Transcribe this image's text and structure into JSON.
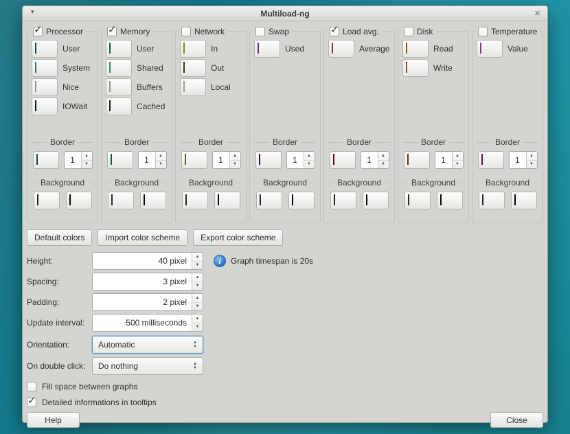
{
  "window": {
    "title": "Multiload-ng"
  },
  "icons": {
    "menu": "▾",
    "close": "×",
    "spin_up": "▲",
    "spin_down": "▼",
    "combo_up": "▲",
    "combo_down": "▼",
    "info": "i",
    "check_glyph": "✓"
  },
  "labels": {
    "border": "Border",
    "background": "Background"
  },
  "graphs": [
    {
      "label": "Processor",
      "check": "✓",
      "colors": [
        {
          "label": "User",
          "color": "#1b7296"
        },
        {
          "label": "System",
          "color": "#4fa8d5"
        },
        {
          "label": "Nice",
          "color": "#c9edfe"
        },
        {
          "label": "IOWait",
          "color": "#07242f"
        }
      ],
      "border": {
        "color": "#1a6a8d",
        "value": "1"
      },
      "background_colors": [
        "#3a3a3a",
        "#0b0b0b"
      ]
    },
    {
      "label": "Memory",
      "check": "✓",
      "colors": [
        {
          "label": "User",
          "color": "#0d9d4b"
        },
        {
          "label": "Shared",
          "color": "#52d389"
        },
        {
          "label": "Buffers",
          "color": "#c7f6db"
        },
        {
          "label": "Cached",
          "color": "#0b3e1e"
        }
      ],
      "border": {
        "color": "#0e9050",
        "value": "1"
      },
      "background_colors": [
        "#3a3a3a",
        "#0b0b0b"
      ]
    },
    {
      "label": "Network",
      "check": "",
      "colors": [
        {
          "label": "In",
          "color": "#d3c70f"
        },
        {
          "label": "Out",
          "color": "#5c5513"
        },
        {
          "label": "Local",
          "color": "#f9f4b3"
        }
      ],
      "border": {
        "color": "#8c8c0e",
        "value": "1"
      },
      "background_colors": [
        "#3a3a3a",
        "#0b0b0b"
      ]
    },
    {
      "label": "Swap",
      "check": "",
      "colors": [
        {
          "label": "Used",
          "color": "#9b44cf"
        }
      ],
      "border": {
        "color": "#5c0f9b",
        "value": "1"
      },
      "background_colors": [
        "#3a3a3a",
        "#0b0b0b"
      ]
    },
    {
      "label": "Load avg.",
      "check": "✓",
      "colors": [
        {
          "label": "Average",
          "color": "#d35052"
        }
      ],
      "border": {
        "color": "#9c0d10",
        "value": "1"
      },
      "background_colors": [
        "#3a3a3a",
        "#0b0b0b"
      ]
    },
    {
      "label": "Disk",
      "check": "",
      "colors": [
        {
          "label": "Read",
          "color": "#e18903"
        },
        {
          "label": "Write",
          "color": "#fb6e04"
        }
      ],
      "border": {
        "color": "#975811",
        "value": "1"
      },
      "background_colors": [
        "#3a3a3a",
        "#0b0b0b"
      ]
    },
    {
      "label": "Temperature",
      "check": "",
      "colors": [
        {
          "label": "Value",
          "color": "#ef3fd4"
        }
      ],
      "border": {
        "color": "#9c0d8a",
        "value": "1"
      },
      "background_colors": [
        "#3a3a3a",
        "#0b0b0b"
      ]
    }
  ],
  "toolbar": {
    "default_colors": "Default colors",
    "import_scheme": "Import color scheme",
    "export_scheme": "Export color scheme"
  },
  "settings": {
    "height": {
      "label": "Height:",
      "value": "40 pixel"
    },
    "spacing": {
      "label": "Spacing:",
      "value": "3 pixel"
    },
    "padding": {
      "label": "Padding:",
      "value": "2 pixel"
    },
    "update_interval": {
      "label": "Update interval:",
      "value": "500 milliseconds"
    },
    "orientation": {
      "label": "Orientation:",
      "value": "Automatic"
    },
    "double_click": {
      "label": "On double click:",
      "value": "Do nothing"
    },
    "info_text": "Graph timespan is 20s"
  },
  "options": [
    {
      "label": "Fill space between graphs",
      "check": ""
    },
    {
      "label": "Detailed informations in tooltips",
      "check": "✓"
    }
  ],
  "footer": {
    "help": "Help",
    "close": "Close"
  }
}
